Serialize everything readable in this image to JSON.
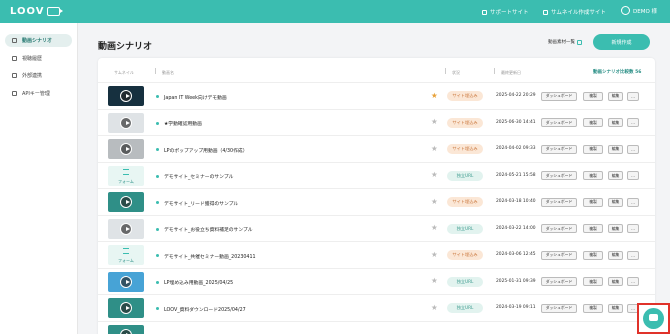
{
  "app": {
    "logo": "LOOV",
    "support": "サポートサイト",
    "thumbnail_site": "サムネイル作成サイト",
    "user": "DEMO 様",
    "brand_color": "#3bbdb0",
    "highlight_color": "#e0322a"
  },
  "sidebar": {
    "items": [
      {
        "label": "動画シナリオ",
        "icon": "video-icon",
        "active": true
      },
      {
        "label": "視聴履歴",
        "icon": "users-icon",
        "active": false
      },
      {
        "label": "外部連携",
        "icon": "external-link-icon",
        "active": false
      },
      {
        "label": "APIキー管理",
        "icon": "key-icon",
        "active": false
      }
    ]
  },
  "main": {
    "title": "動画シナリオ",
    "material_list": "動画素材一覧",
    "new_button": "新規作成",
    "columns": {
      "thumbnail": "サムネイル",
      "name": "動画名",
      "status": "状況",
      "updated": "最終更新日"
    },
    "plan_link": "動画シナリオ比較数 56",
    "row_actions": {
      "dashboard": "ダッシュボード",
      "copy": "複製",
      "edit": "編集",
      "more": "…"
    },
    "rows": [
      {
        "name": "Japan IT Week向けデモ動画",
        "status": "サイト埋込み",
        "status_type": "pub",
        "date": "2025-04-22 20:29",
        "starred": true,
        "thumb": "dark"
      },
      {
        "name": "★学動確認用動画",
        "status": "サイト埋込み",
        "status_type": "pub",
        "date": "2025-06-30 14:41",
        "starred": false,
        "thumb": "person"
      },
      {
        "name": "LPのポップアップ用動画（4/30作成）",
        "status": "サイト埋込み",
        "status_type": "pub",
        "date": "2024-04-02 09:33",
        "starred": false,
        "thumb": "gray"
      },
      {
        "name": "デモサイト_セミナーのサンプル",
        "status": "独立URL",
        "status_type": "url",
        "date": "2024-05-21 15:58",
        "starred": false,
        "thumb": "form",
        "thumb_label": "フォーム"
      },
      {
        "name": "デモサイト_リード獲得のサンプル",
        "status": "サイト埋込み",
        "status_type": "pub",
        "date": "2024-03-18 10:40",
        "starred": false,
        "thumb": "teal"
      },
      {
        "name": "デモサイト_お役立ち資料補足のサンプル",
        "status": "独立URL",
        "status_type": "url",
        "date": "2024-03-22 14:00",
        "starred": false,
        "thumb": "person"
      },
      {
        "name": "デモサイト_共催セミナー動画_20230411",
        "status": "サイト埋込み",
        "status_type": "pub",
        "date": "2024-03-06 12:45",
        "starred": false,
        "thumb": "form",
        "thumb_label": "フォーム"
      },
      {
        "name": "LP埋め込み用動画_2025/04/25",
        "status": "独立URL",
        "status_type": "url",
        "date": "2025-01-31 09:39",
        "starred": false,
        "thumb": "blue"
      },
      {
        "name": "LOOV_資料ダウンロード2025/04/27",
        "status": "独立URL",
        "status_type": "url",
        "date": "2024-03-19 09:11",
        "starred": false,
        "thumb": "teal"
      },
      {
        "name": "",
        "status": "",
        "status_type": "",
        "date": "",
        "starred": false,
        "thumb": "teal"
      }
    ]
  }
}
